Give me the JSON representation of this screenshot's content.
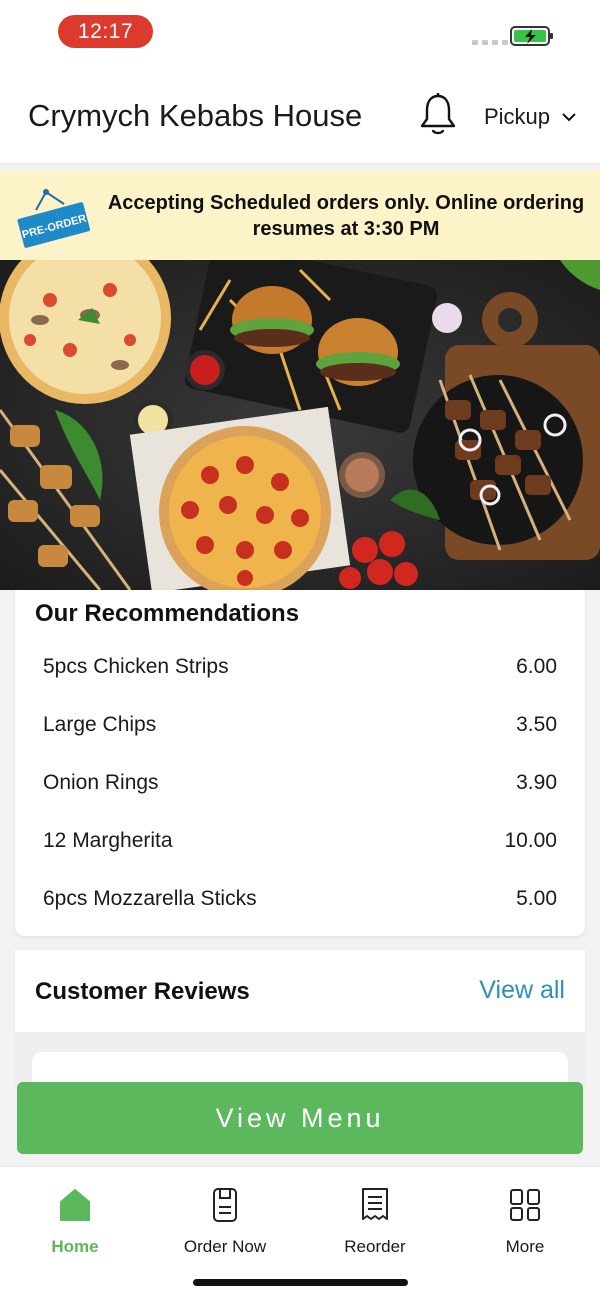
{
  "status": {
    "time": "12:17"
  },
  "header": {
    "store_name": "Crymych Kebabs House",
    "order_mode": "Pickup"
  },
  "banner": {
    "tag_text": "PRE-ORDER",
    "message": "Accepting Scheduled orders only. Online ordering resumes at 3:30 PM"
  },
  "recommendations": {
    "title": "Our Recommendations",
    "items": [
      {
        "name": "5pcs Chicken Strips",
        "price": "6.00"
      },
      {
        "name": "Large Chips",
        "price": "3.50"
      },
      {
        "name": "Onion Rings",
        "price": "3.90"
      },
      {
        "name": "12 Margherita",
        "price": "10.00"
      },
      {
        "name": "6pcs Mozzarella Sticks",
        "price": "5.00"
      }
    ]
  },
  "reviews": {
    "title": "Customer Reviews",
    "view_all": "View all"
  },
  "cta": {
    "view_menu": "View Menu"
  },
  "tabs": [
    {
      "label": "Home",
      "icon": "home-icon",
      "active": true
    },
    {
      "label": "Order Now",
      "icon": "order-now-icon",
      "active": false
    },
    {
      "label": "Reorder",
      "icon": "receipt-icon",
      "active": false
    },
    {
      "label": "More",
      "icon": "grid-icon",
      "active": false
    }
  ],
  "colors": {
    "accent_green": "#5cb85c",
    "link_blue": "#2f8fb8",
    "banner_bg": "#fdf3c9",
    "time_pill": "#dd3a2e"
  }
}
